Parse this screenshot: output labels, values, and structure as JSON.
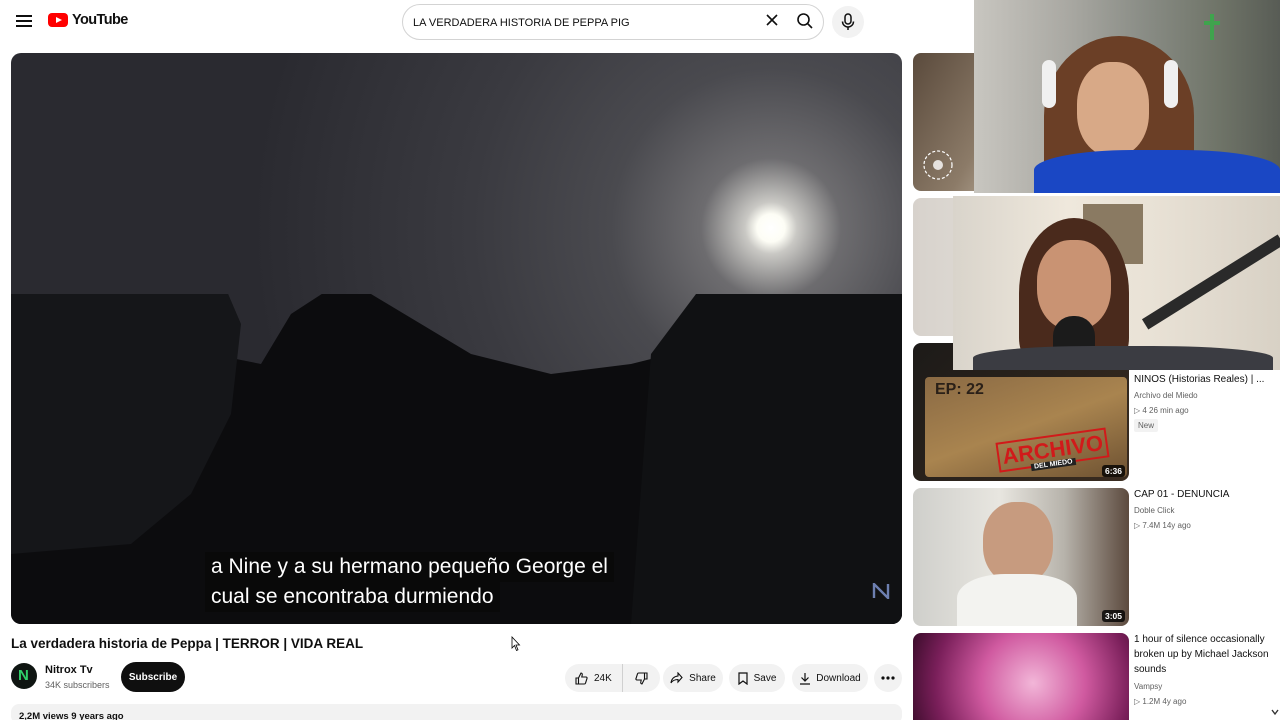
{
  "brand": {
    "logo_text": "YouTube"
  },
  "search": {
    "query": "LA VERDADERA HISTORIA DE PEPPA PIG"
  },
  "player": {
    "subtitles": [
      "a Nine y a su hermano pequeño George el",
      "cual se encontraba durmiendo"
    ]
  },
  "video": {
    "title": "La verdadera historia de Peppa | TERROR | VIDA REAL",
    "channel": "Nitrox Tv",
    "channel_initial": "N",
    "subscribers": "34K subscribers",
    "subscribe_label": "Subscribe",
    "likes": "24K",
    "share_label": "Share",
    "save_label": "Save",
    "download_label": "Download",
    "views_line": "2,2M views  9 years ago"
  },
  "recommendations": [
    {
      "title": "NINOS (Historias Reales) | ...",
      "channel": "Archivo del Miedo",
      "meta": "4  26 min ago",
      "badge": "New",
      "duration": "6:36",
      "thumb_text_top": "EP: 22",
      "thumb_text_main": "ARCHIVO",
      "thumb_text_sub": "DEL MIEDO"
    },
    {
      "title": "CAP 01 - DENUNCIA",
      "channel": "Doble Click",
      "meta": "7.4M  14y ago",
      "duration": "3:05"
    },
    {
      "title": "1 hour of silence occasionally broken up by Michael Jackson sounds",
      "channel": "Vampsy",
      "meta": "1.2M  4y ago"
    }
  ],
  "colors": {
    "brand_red": "#ff0000",
    "subscribe_bg": "#0f0f0f",
    "pill_bg": "#f2f2f2"
  }
}
